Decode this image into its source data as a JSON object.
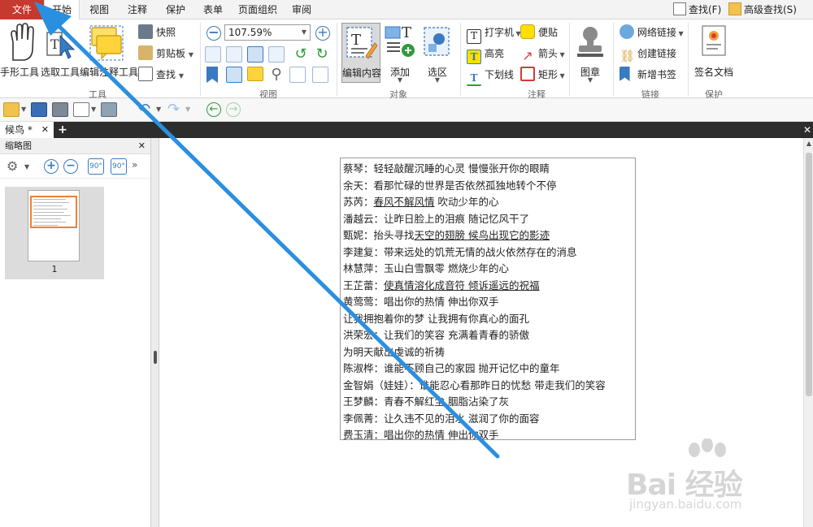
{
  "menubar": {
    "tabs": [
      "文件",
      "开始",
      "视图",
      "注释",
      "保护",
      "表单",
      "页面组织",
      "审阅"
    ],
    "search": "查找(F)",
    "advanced_search": "高级查找(S)"
  },
  "ribbon": {
    "tools_group": {
      "label": "工具",
      "hand_tool": "手形工具",
      "select_tool": "选取工具",
      "edit_annotation_tool": "编辑注释工具",
      "snapshot": "快照",
      "clipboard": "剪贴板",
      "find": "查找"
    },
    "view_group": {
      "label": "视图",
      "zoom": "107.59%"
    },
    "object_group": {
      "label": "对象",
      "edit_content": "编辑内容",
      "add": "添加",
      "select_area": "选区"
    },
    "annotation_group": {
      "label": "注释",
      "typewriter": "打字机",
      "highlight": "高亮",
      "underline": "下划线",
      "note": "便贴",
      "arrow": "箭头",
      "rectangle": "矩形",
      "stamp": "图章"
    },
    "links_group": {
      "label": "链接",
      "web_link": "网络链接",
      "create_link": "创建链接",
      "new_bookmark": "新增书签"
    },
    "protect_group": {
      "label": "保护",
      "sign_document": "签名文档"
    }
  },
  "document_tab": {
    "title": "候鸟 *"
  },
  "sidebar": {
    "title": "缩略图",
    "page_number": "1"
  },
  "document": {
    "lines": [
      {
        "speaker": "蔡琴：",
        "text": "轻轻敲醒沉睡的心灵  慢慢张开你的眼睛",
        "underlined": false
      },
      {
        "speaker": "余天：",
        "text": "看那忙碌的世界是否依然孤独地转个不停",
        "underlined": false
      },
      {
        "speaker": "苏芮：",
        "text": "春风不解风情",
        "tail": "  吹动少年的心",
        "underlined": true
      },
      {
        "speaker": "潘越云：",
        "text": "让昨日脸上的泪痕  随记忆风干了",
        "underlined": false
      },
      {
        "speaker": "甄妮：",
        "text": "抬头寻找",
        "uline_part": "天空的翅膀  候鸟出现它的影迹",
        "underlined": true
      },
      {
        "speaker": "李建复：",
        "text": "带来远处的饥荒无情的战火依然存在的消息",
        "underlined": false
      },
      {
        "speaker": "林慧萍：",
        "text": "玉山白雪飘零  燃烧少年的心",
        "underlined": false
      },
      {
        "speaker": "王芷蕾：",
        "text": "使真情溶化成音符  倾诉遥远的祝福",
        "underlined": true
      },
      {
        "speaker": "黄莺莺：",
        "text": "唱出你的热情  伸出你双手",
        "underlined": false
      },
      {
        "speaker": "",
        "text": "让我拥抱着你的梦  让我拥有你真心的面孔",
        "underlined": false
      },
      {
        "speaker": "洪荣宏：",
        "text": "让我们的笑容  充满着青春的骄傲",
        "underlined": false
      },
      {
        "speaker": "",
        "text": "为明天献出虔诚的祈祷",
        "underlined": false
      },
      {
        "speaker": "陈淑桦：",
        "text": "谁能不顾自己的家园  抛开记忆中的童年",
        "underlined": false
      },
      {
        "speaker": "金智娟（娃娃）：",
        "text": "谁能忍心看那昨日的忧愁  带走我们的笑容",
        "underlined": false
      },
      {
        "speaker": "王梦麟：",
        "text": "青春不解红尘  胭脂沾染了灰",
        "underlined": false
      },
      {
        "speaker": "李佩菁：",
        "text": "让久违不见的泪水  滋润了你的面容",
        "underlined": false
      },
      {
        "speaker": "费玉清：",
        "text": "唱出你的热情  伸出你双手",
        "underlined": false
      }
    ]
  },
  "watermark": {
    "brand": "Bai 经验",
    "url": "jingyan.baidu.com"
  },
  "colors": {
    "file_tab": "#c6392f",
    "accent_blue": "#3a7ac0",
    "arrow": "#2b8fe0",
    "thumb_highlight": "#f08030",
    "tab_strip": "#2d2d2d"
  },
  "icons": {
    "hand_tool": "hand-icon",
    "select_tool": "cursor-select-icon",
    "edit_annotation": "annotation-edit-icon",
    "snapshot": "camera-icon",
    "clipboard": "clipboard-icon",
    "find": "find-icon",
    "zoom_out": "zoom-out-icon",
    "zoom_in": "zoom-in-icon",
    "rotate_left": "rotate-left-icon",
    "rotate_right": "rotate-right-icon",
    "stamp": "stamp-icon",
    "sign": "certificate-icon"
  }
}
